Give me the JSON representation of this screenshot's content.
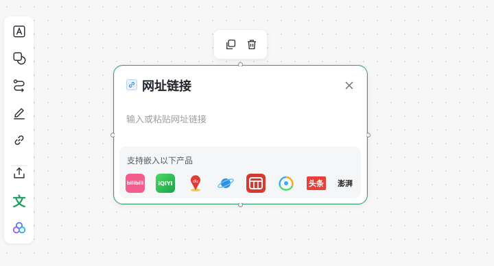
{
  "toolbar": {
    "tools": [
      {
        "name": "text-tool",
        "icon": "text-box-icon"
      },
      {
        "name": "shape-tool",
        "icon": "shapes-icon"
      },
      {
        "name": "connector-tool",
        "icon": "connector-icon"
      },
      {
        "name": "pen-tool",
        "icon": "pen-icon"
      },
      {
        "name": "link-tool",
        "icon": "link-icon"
      },
      {
        "name": "upload-tool",
        "icon": "upload-icon"
      },
      {
        "name": "doc-tool",
        "icon": "doc-text-icon",
        "glyph": "文"
      },
      {
        "name": "more-tool",
        "icon": "apps-icon"
      }
    ]
  },
  "float_menu": {
    "items": [
      {
        "name": "copy-button",
        "icon": "copy-icon"
      },
      {
        "name": "delete-button",
        "icon": "trash-icon"
      }
    ]
  },
  "card": {
    "title": "网址链接",
    "input": {
      "value": "",
      "placeholder": "输入或粘贴网址链接"
    },
    "products": {
      "label": "支持嵌入以下产品",
      "items": [
        {
          "name": "bilibili",
          "badge": "bilibili",
          "color": "#f25d8e"
        },
        {
          "name": "iqiyi",
          "badge": "iQIYI",
          "color": "#3cc54a"
        },
        {
          "name": "baidu-map",
          "badge": "du",
          "color": "#e53935"
        },
        {
          "name": "planet",
          "badge": "",
          "color": "#3a86d8"
        },
        {
          "name": "netease-cloud-music",
          "badge": "",
          "color": "#d33a31"
        },
        {
          "name": "tencent-video",
          "badge": "",
          "color": "#3fa9f5"
        },
        {
          "name": "toutiao",
          "badge": "头条",
          "color": "#e8413c"
        },
        {
          "name": "the-paper",
          "badge": "澎湃",
          "color": "#222222"
        }
      ]
    }
  },
  "colors": {
    "accent": "#3aa56f",
    "doc_green": "#1f9e62"
  }
}
